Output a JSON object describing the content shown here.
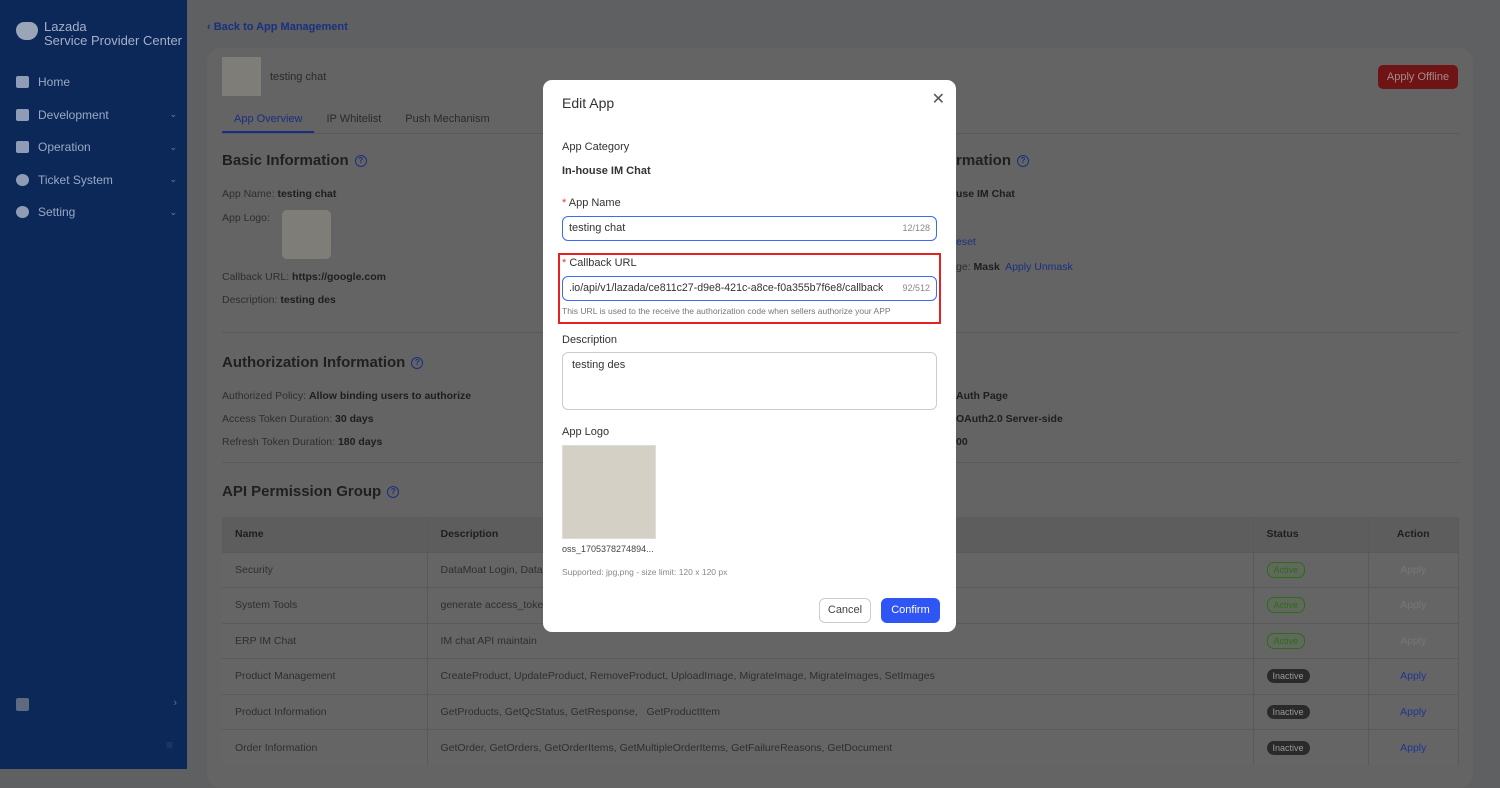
{
  "sidebar": {
    "brand_line1": "Lazada",
    "brand_line2": "Service Provider Center",
    "items": [
      {
        "label": "Home"
      },
      {
        "label": "Development"
      },
      {
        "label": "Operation"
      },
      {
        "label": "Ticket System"
      },
      {
        "label": "Setting"
      }
    ]
  },
  "header": {
    "back": "Back to App Management",
    "app_name": "testing chat",
    "apply_offline": "Apply Offline",
    "tabs": [
      "App Overview",
      "IP Whitelist",
      "Push Mechanism"
    ]
  },
  "basic": {
    "title": "Basic Information",
    "app_name_label": "App Name:",
    "app_name": "testing chat",
    "app_logo_label": "App Logo:",
    "callback_label": "Callback URL:",
    "callback": "https://google.com",
    "desc_label": "Description:",
    "desc": "testing des"
  },
  "right_col": {
    "title_fragment": "rmation",
    "category_fragment": "use IM Chat",
    "reset_fragment": "eset",
    "mask_label_fragment": "ge:",
    "mask_value": "Mask",
    "apply_unmask": "Apply Unmask",
    "auth_page_fragment": "Auth Page",
    "oauth_fragment": "OAuth2.0 Server-side",
    "num_fragment": "00"
  },
  "auth": {
    "title": "Authorization Information",
    "policy_label": "Authorized Policy:",
    "policy": "Allow binding users to authorize",
    "access_label": "Access Token Duration:",
    "access": "30 days",
    "refresh_label": "Refresh Token Duration:",
    "refresh": "180 days"
  },
  "api": {
    "title": "API Permission Group",
    "columns": [
      "Name",
      "Description",
      "Status",
      "Action"
    ],
    "rows": [
      {
        "name": "Security",
        "desc": "DataMoat Login, Data",
        "status": "Active",
        "action": "Apply"
      },
      {
        "name": "System Tools",
        "desc": "generate access_toke",
        "status": "Active",
        "action": "Apply"
      },
      {
        "name": "ERP IM Chat",
        "desc": "IM chat API maintain",
        "status": "Active",
        "action": "Apply"
      },
      {
        "name": "Product Management",
        "desc": "CreateProduct, UpdateProduct, RemoveProduct, UploadImage, MigrateImage, MigrateImages, SetImages",
        "status": "Inactive",
        "action": "Apply"
      },
      {
        "name": "Product Information",
        "desc": "GetProducts, GetQcStatus, GetResponse,   GetProductItem",
        "status": "Inactive",
        "action": "Apply"
      },
      {
        "name": "Order Information",
        "desc": "GetOrder, GetOrders, GetOrderItems, GetMultipleOrderItems, GetFailureReasons, GetDocument",
        "status": "Inactive",
        "action": "Apply"
      }
    ]
  },
  "modal": {
    "title": "Edit App",
    "category_label": "App Category",
    "category": "In-house IM Chat",
    "name_label": "App Name",
    "name_value": "testing chat",
    "name_count": "12/128",
    "callback_label": "Callback URL",
    "callback_value": ".io/api/v1/lazada/ce811c27-d9e8-421c-a8ce-f0a355b7f6e8/callback",
    "callback_count": "92/512",
    "callback_hint": "This URL is used to the receive the authorization code when sellers authorize your APP",
    "desc_label": "Description",
    "desc_value": "testing des",
    "logo_label": "App Logo",
    "logo_filename": "oss_1705378274894...",
    "logo_hint": "Supported: jpg,png - size limit: 120 x 120 px",
    "cancel": "Cancel",
    "confirm": "Confirm"
  },
  "colors": {
    "accent": "#2f55f5",
    "danger": "#ef2f2f",
    "sidebar": "#1b63d8"
  }
}
